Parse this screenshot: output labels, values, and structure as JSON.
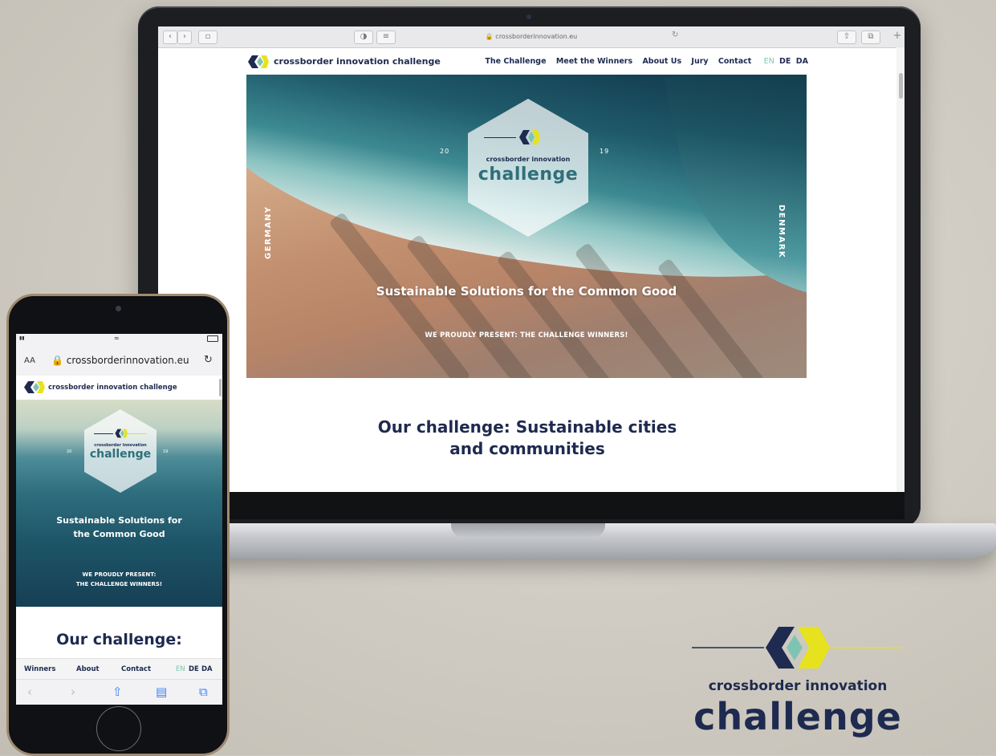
{
  "browser": {
    "url": "crossborderinnovation.eu",
    "plus_label": "+"
  },
  "site": {
    "name": "crossborder innovation challenge",
    "nav": [
      "The Challenge",
      "Meet the Winners",
      "About Us",
      "Jury",
      "Contact"
    ],
    "languages": [
      "EN",
      "DE",
      "DA"
    ],
    "active_language": "EN"
  },
  "hero": {
    "logo_sub": "crossborder innovation",
    "logo_main": "challenge",
    "year_left": "20",
    "year_right": "19",
    "left_label": "GERMANY",
    "right_label": "DENMARK",
    "title": "Sustainable Solutions for the Common Good",
    "subtitle": "WE PROUDLY PRESENT: THE CHALLENGE WINNERS!"
  },
  "section": {
    "heading": "Our challenge: Sustainable cities and communities"
  },
  "phone": {
    "aa_label": "AA",
    "url": "crossborderinnovation.eu",
    "site_name": "crossborder innovation challenge",
    "hero_title": "Sustainable Solutions for the Common Good",
    "hero_subtitle_line1": "WE PROUDLY PRESENT:",
    "hero_subtitle_line2": "THE CHALLENGE WINNERS!",
    "heading": "Our challenge:",
    "bottom_nav": [
      "Winners",
      "About",
      "Contact"
    ],
    "languages": [
      "EN",
      "DE",
      "DA"
    ]
  },
  "brand_logo": {
    "sub": "crossborder innovation",
    "main": "challenge"
  },
  "colors": {
    "navy": "#1e2a4f",
    "teal": "#7fc4b2",
    "yellow": "#e6e21e"
  },
  "icons": [
    "back-icon",
    "forward-icon",
    "sidebar-icon",
    "privacy-icon",
    "reader-icon",
    "reload-icon",
    "share-icon",
    "tabs-icon",
    "lock-icon",
    "bookmarks-icon",
    "wifi-icon",
    "battery-icon"
  ]
}
